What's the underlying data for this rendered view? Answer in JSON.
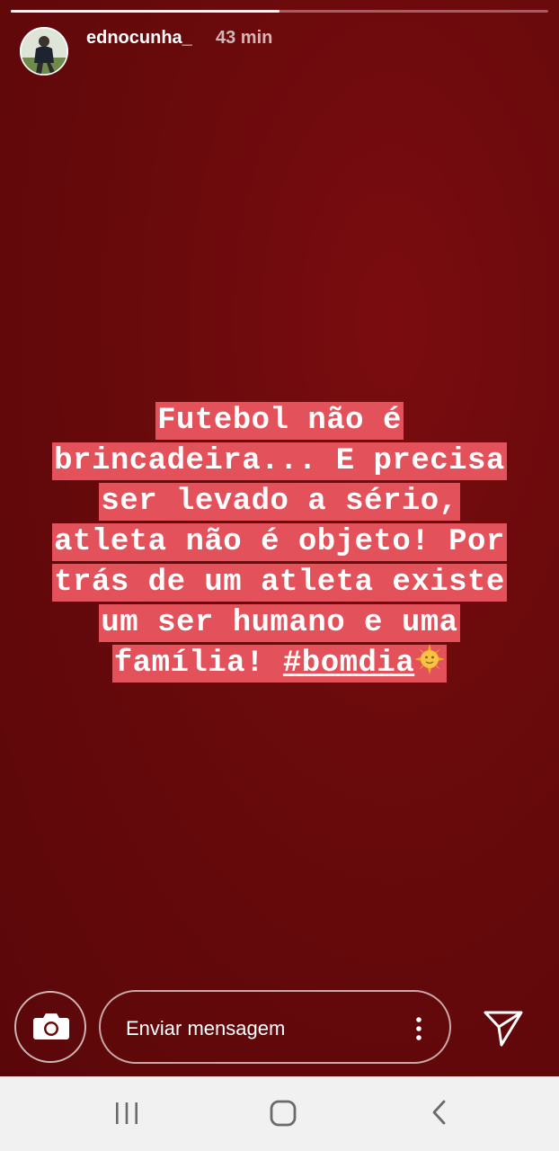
{
  "story": {
    "progress": 0.5,
    "user": {
      "username": "ednocunha_",
      "time_ago": "43 min"
    },
    "caption": {
      "lines": [
        "Futebol não é",
        "brincadeira... E precisa",
        "ser levado a sério,",
        "atleta não é objeto! Por",
        "trás de um atleta existe",
        "um ser humano e uma"
      ],
      "last_line_prefix": "família! ",
      "hashtag": "#bomdia",
      "emoji": "sun-with-face"
    },
    "caption_highlight_color": "#e3515b"
  },
  "reply_bar": {
    "placeholder": "Enviar mensagem",
    "camera_icon": "camera-icon",
    "more_icon": "more-vertical-icon",
    "send_icon": "send-icon"
  },
  "android_nav": {
    "recent_icon": "recent-apps-icon",
    "home_icon": "home-icon",
    "back_icon": "back-icon"
  }
}
